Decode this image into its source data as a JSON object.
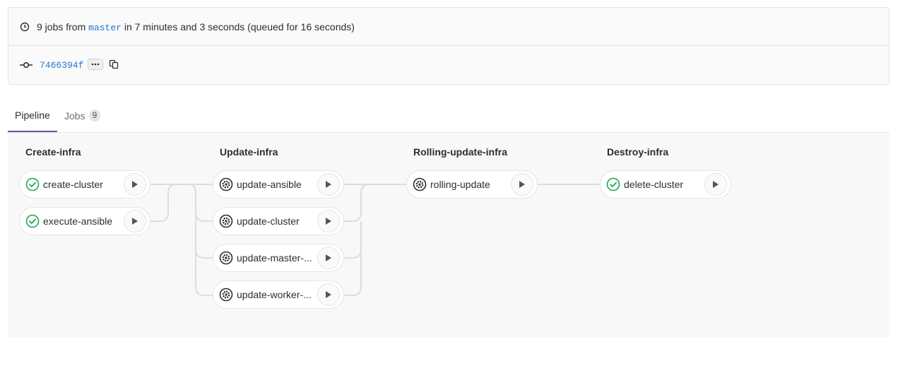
{
  "header": {
    "jobs_count_text": "9 jobs from",
    "ref": "master",
    "duration_text": "in 7 minutes and 3 seconds (queued for 16 seconds)",
    "commit_sha": "7466394f"
  },
  "tabs": [
    {
      "label": "Pipeline",
      "active": true
    },
    {
      "label": "Jobs",
      "count": "9",
      "active": false
    }
  ],
  "stages": [
    {
      "title": "Create-infra",
      "jobs": [
        {
          "name": "create-cluster",
          "status": "success"
        },
        {
          "name": "execute-ansible",
          "status": "success"
        }
      ]
    },
    {
      "title": "Update-infra",
      "jobs": [
        {
          "name": "update-ansible",
          "status": "manual"
        },
        {
          "name": "update-cluster",
          "status": "manual"
        },
        {
          "name": "update-master-...",
          "status": "manual"
        },
        {
          "name": "update-worker-...",
          "status": "manual"
        }
      ]
    },
    {
      "title": "Rolling-update-infra",
      "jobs": [
        {
          "name": "rolling-update",
          "status": "manual"
        }
      ]
    },
    {
      "title": "Destroy-infra",
      "jobs": [
        {
          "name": "delete-cluster",
          "status": "success"
        }
      ]
    }
  ],
  "colors": {
    "success": "#1aaa55",
    "manual": "#2e2e2e",
    "link": "#1f78d1",
    "active_tab": "#6b4fbb"
  }
}
